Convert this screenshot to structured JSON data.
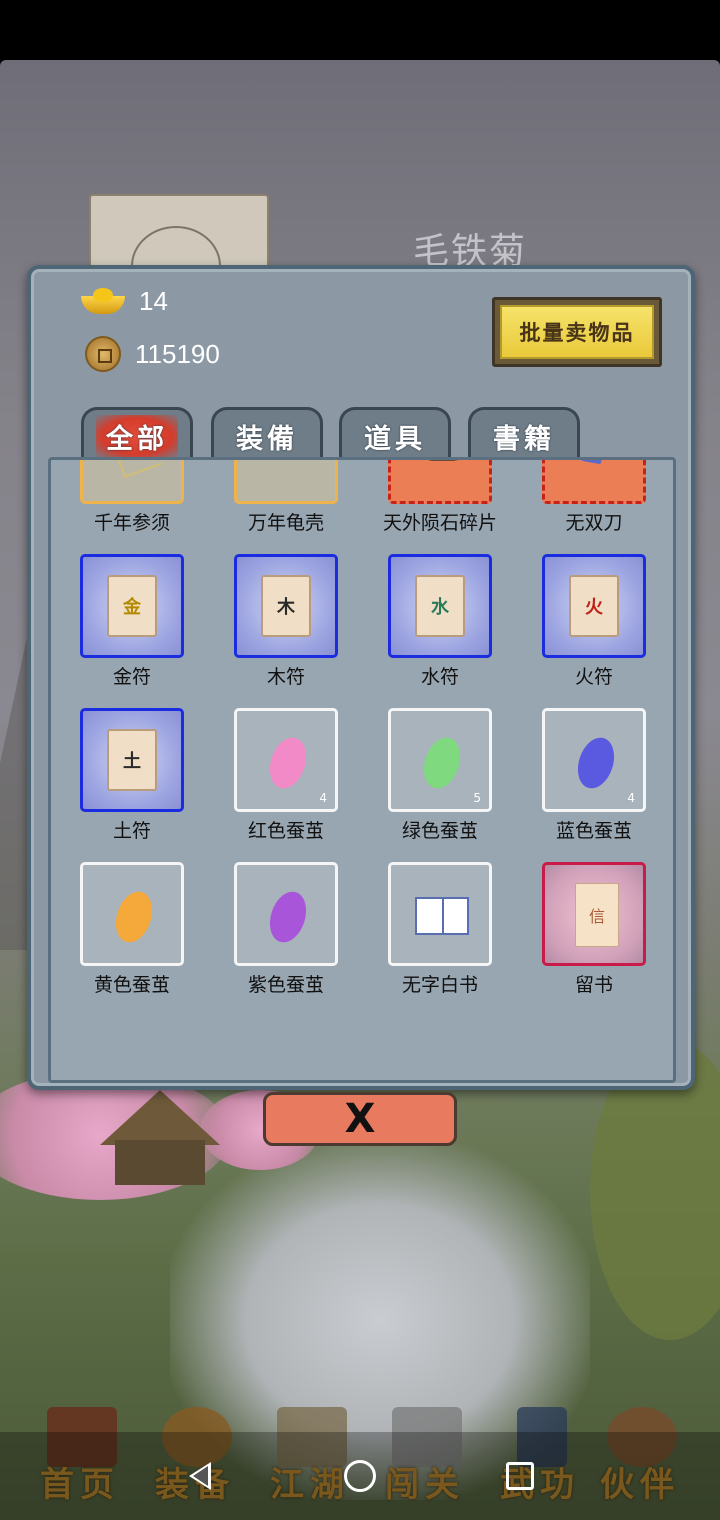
{
  "background": {
    "npc_name": "毛铁菊"
  },
  "currency": {
    "ingot_value": "14",
    "coin_value": "115190"
  },
  "actions": {
    "bulk_sell_label": "批量卖物品",
    "close_symbol": "X"
  },
  "tabs": [
    {
      "label": "全部",
      "active": true
    },
    {
      "label": "装備",
      "active": false
    },
    {
      "label": "道具",
      "active": false
    },
    {
      "label": "書籍",
      "active": false
    }
  ],
  "items": [
    {
      "name": "千年参须",
      "rarity": "yellow",
      "icon": "ginseng-root-icon",
      "count": ""
    },
    {
      "name": "万年龟壳",
      "rarity": "yellow",
      "icon": "turtle-shell-icon",
      "count": ""
    },
    {
      "name": "天外陨石碎片",
      "rarity": "red",
      "icon": "meteorite-fragment-icon",
      "count": ""
    },
    {
      "name": "无双刀",
      "rarity": "red",
      "icon": "blade-icon",
      "count": ""
    },
    {
      "name": "金符",
      "rarity": "blue",
      "icon": "talisman-icon",
      "glyph": "金",
      "glyph_color": "#b38a00",
      "count": ""
    },
    {
      "name": "木符",
      "rarity": "blue",
      "icon": "talisman-icon",
      "glyph": "木",
      "glyph_color": "#2a2a2a",
      "count": ""
    },
    {
      "name": "水符",
      "rarity": "blue",
      "icon": "talisman-icon",
      "glyph": "水",
      "glyph_color": "#2a7a5a",
      "count": ""
    },
    {
      "name": "火符",
      "rarity": "blue",
      "icon": "talisman-icon",
      "glyph": "火",
      "glyph_color": "#c0201a",
      "count": ""
    },
    {
      "name": "土符",
      "rarity": "blue",
      "icon": "talisman-icon",
      "glyph": "土",
      "glyph_color": "#2a2a2a",
      "count": ""
    },
    {
      "name": "红色蚕茧",
      "rarity": "white",
      "icon": "cocoon-icon",
      "cocoon_color": "#f28ac7",
      "count": "4"
    },
    {
      "name": "绿色蚕茧",
      "rarity": "white",
      "icon": "cocoon-icon",
      "cocoon_color": "#7fd97f",
      "count": "5"
    },
    {
      "name": "蓝色蚕茧",
      "rarity": "white",
      "icon": "cocoon-icon",
      "cocoon_color": "#5a5ae0",
      "count": "4"
    },
    {
      "name": "黄色蚕茧",
      "rarity": "white",
      "icon": "cocoon-icon",
      "cocoon_color": "#f5a93a",
      "count": ""
    },
    {
      "name": "紫色蚕茧",
      "rarity": "white",
      "icon": "cocoon-icon",
      "cocoon_color": "#a955d9",
      "count": ""
    },
    {
      "name": "无字白书",
      "rarity": "white",
      "icon": "blank-book-icon",
      "count": ""
    },
    {
      "name": "留书",
      "rarity": "crimson",
      "icon": "letter-icon",
      "glyph": "信",
      "count": ""
    }
  ],
  "bottom_nav": [
    {
      "label": "首页",
      "icon": "home-building-icon"
    },
    {
      "label": "装备",
      "icon": "armor-icon"
    },
    {
      "label": "江湖",
      "icon": "scroll-map-icon"
    },
    {
      "label": "闯关",
      "icon": "crossed-swords-icon"
    },
    {
      "label": "武功",
      "icon": "martial-book-icon"
    },
    {
      "label": "伙伴",
      "icon": "companions-icon"
    }
  ],
  "system_nav": [
    {
      "icon": "back-triangle-icon"
    },
    {
      "icon": "home-circle-icon"
    },
    {
      "icon": "recents-square-icon"
    }
  ]
}
